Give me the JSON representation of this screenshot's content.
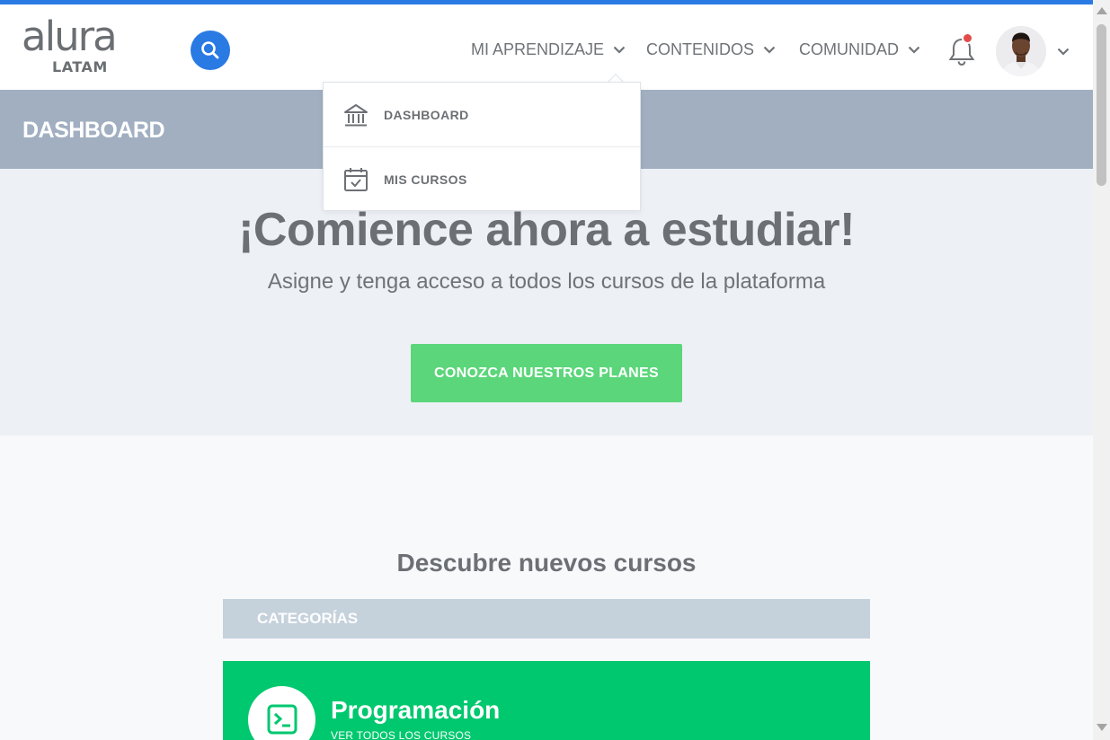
{
  "colors": {
    "brand_blue": "#2a7ae4",
    "dashboard_bar": "#a1afc1",
    "hero_bg": "#edf1f5",
    "cta_green": "#5bd67a",
    "category_green": "#00c86f",
    "notification_dot": "#e24b4b"
  },
  "header": {
    "logo_main": "alura",
    "logo_sub": "LATAM",
    "search_icon": "search-icon",
    "nav": [
      {
        "label": "MI APRENDIZAJE",
        "icon": "chevron-down-icon"
      },
      {
        "label": "CONTENIDOS",
        "icon": "chevron-down-icon"
      },
      {
        "label": "COMUNIDAD",
        "icon": "chevron-down-icon"
      }
    ],
    "bell_icon": "bell-icon",
    "avatar_chevron_icon": "chevron-down-icon"
  },
  "dropdown": {
    "items": [
      {
        "label": "DASHBOARD",
        "icon": "bank-building-icon"
      },
      {
        "label": "MIS CURSOS",
        "icon": "calendar-check-icon"
      }
    ]
  },
  "dashboard": {
    "title": "DASHBOARD"
  },
  "hero": {
    "title": "¡Comience ahora a estudiar!",
    "subtitle": "Asigne y tenga acceso a todos los cursos de la plataforma",
    "cta": "CONOZCA NUESTROS PLANES"
  },
  "discover": {
    "heading": "Descubre nuevos cursos",
    "categories_label": "CATEGORÍAS",
    "card": {
      "title": "Programación",
      "link": "VER TODOS LOS CURSOS",
      "icon": "terminal-icon"
    }
  }
}
